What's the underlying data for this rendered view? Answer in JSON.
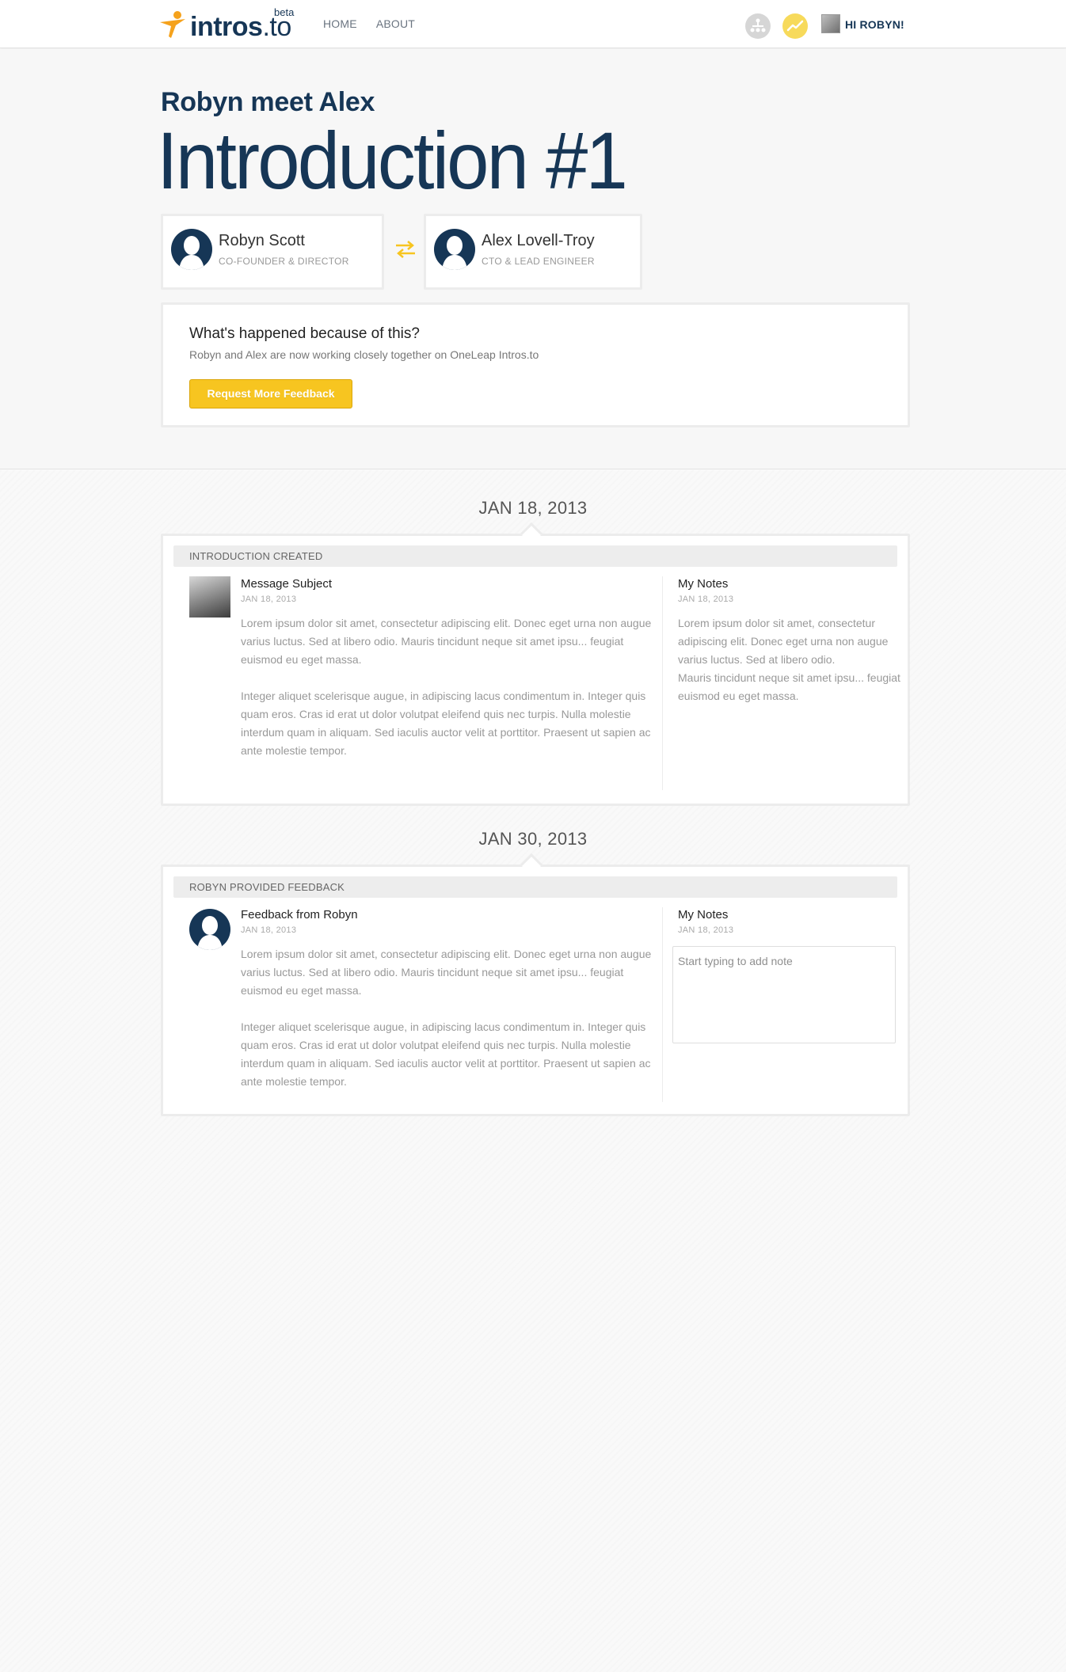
{
  "header": {
    "logo_text": "intros",
    "logo_suffix": ".to",
    "logo_badge": "beta",
    "nav": [
      {
        "label": "HOME"
      },
      {
        "label": "ABOUT"
      }
    ],
    "icons": {
      "network": "network-icon",
      "activity": "activity-icon"
    },
    "greeting": "HI ROBYN!"
  },
  "hero": {
    "subtitle": "Robyn meet Alex",
    "title": "Introduction #1",
    "people": [
      {
        "name": "Robyn Scott",
        "role": "CO-FOUNDER & DIRECTOR"
      },
      {
        "name": "Alex Lovell-Troy",
        "role": "CTO & LEAD ENGINEER"
      }
    ],
    "outcome": {
      "title": "What's happened because of this?",
      "text": "Robyn and Alex are now working closely together on OneLeap Intros.to",
      "button_label": "Request More Feedback"
    }
  },
  "timeline": [
    {
      "date": "JAN 18, 2013",
      "band": "INTRODUCTION CREATED",
      "message": {
        "subject": "Message Subject",
        "date": "JAN 18, 2013",
        "paragraphs": [
          "Lorem ipsum dolor sit amet, consectetur adipiscing elit. Donec eget urna non augue varius luctus. Sed at libero odio. Mauris tincidunt neque sit amet ipsu... feugiat euismod eu eget massa.",
          "Integer aliquet scelerisque augue, in adipiscing lacus condimentum in. Integer quis quam eros. Cras id erat ut dolor volutpat eleifend quis nec turpis. Nulla molestie interdum quam in aliquam. Sed iaculis auctor velit at porttitor. Praesent ut sapien ac ante molestie tempor."
        ]
      },
      "notes": {
        "title": "My Notes",
        "date": "JAN 18, 2013",
        "paragraphs": [
          "Lorem ipsum dolor sit amet, consectetur adipiscing elit. Donec eget urna non augue varius luctus. Sed at libero odio.",
          "Mauris tincidunt neque sit amet ipsu... feugiat euismod eu eget massa."
        ]
      }
    },
    {
      "date": "JAN 30, 2013",
      "band": "ROBYN PROVIDED FEEDBACK",
      "message": {
        "subject": "Feedback from Robyn",
        "date": "JAN 18, 2013",
        "paragraphs": [
          "Lorem ipsum dolor sit amet, consectetur adipiscing elit. Donec eget urna non augue varius luctus. Sed at libero odio. Mauris tincidunt neque sit amet ipsu... feugiat euismod eu eget massa.",
          "Integer aliquet scelerisque augue, in adipiscing lacus condimentum in. Integer quis quam eros. Cras id erat ut dolor volutpat eleifend quis nec turpis. Nulla molestie interdum quam in aliquam. Sed iaculis auctor velit at porttitor. Praesent ut sapien ac ante molestie tempor."
        ]
      },
      "notes": {
        "title": "My Notes",
        "date": "JAN 18, 2013",
        "placeholder": "Start typing to add note"
      }
    }
  ],
  "colors": {
    "brand_navy": "#163656",
    "accent_yellow": "#f7c520",
    "logo_orange": "#f5a21c"
  }
}
